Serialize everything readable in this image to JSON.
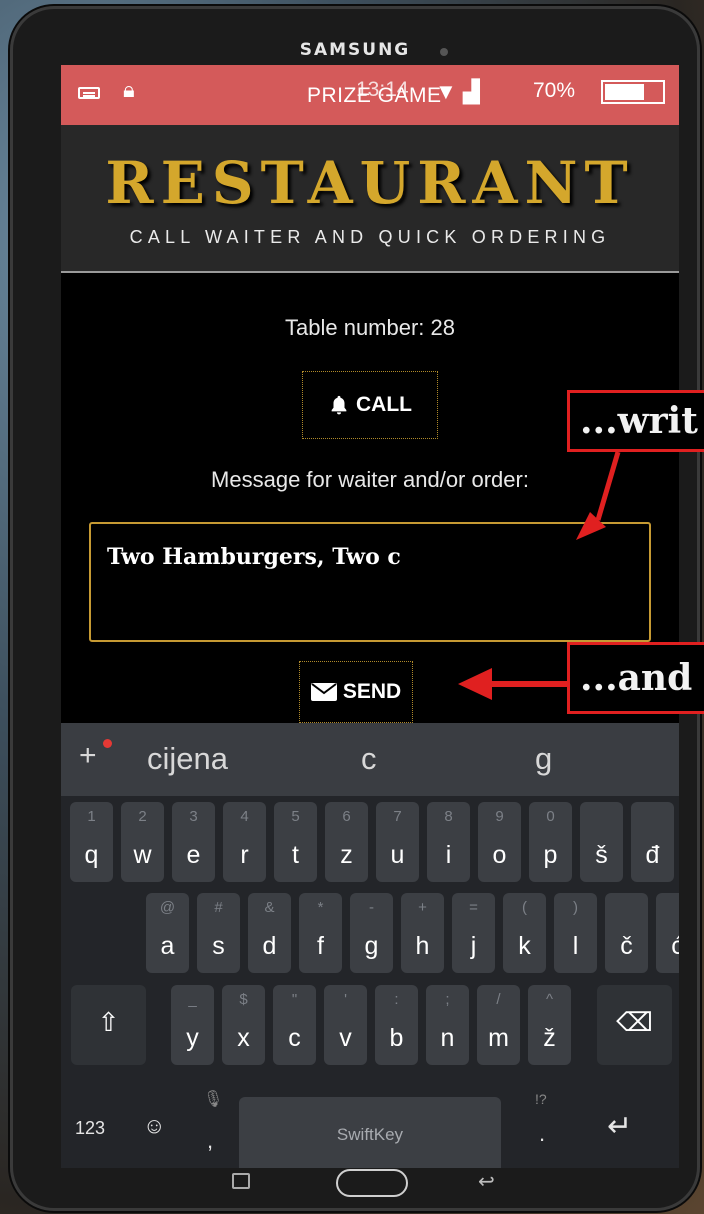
{
  "device": {
    "brand": "SAMSUNG"
  },
  "status_bar": {
    "app_name": "PRIZE GAME",
    "time": "13:14",
    "battery": "70%",
    "battery_level": 0.7,
    "bg_color": "#d45a5a"
  },
  "header": {
    "title": "RESTAURANT",
    "subtitle": "CALL WAITER AND QUICK ORDERING",
    "title_color": "#d4a72c"
  },
  "main": {
    "table_label": "Table number: 28",
    "call_button": "CALL",
    "message_label": "Message for waiter and/or order:",
    "message_value": "Two Hamburgers, Two c",
    "send_button": "SEND"
  },
  "keyboard": {
    "suggestions": [
      "cijena",
      "c",
      "g"
    ],
    "rows": [
      [
        {
          "p": "q",
          "s": "1"
        },
        {
          "p": "w",
          "s": "2"
        },
        {
          "p": "e",
          "s": "3"
        },
        {
          "p": "r",
          "s": "4"
        },
        {
          "p": "t",
          "s": "5"
        },
        {
          "p": "z",
          "s": "6"
        },
        {
          "p": "u",
          "s": "7"
        },
        {
          "p": "i",
          "s": "8"
        },
        {
          "p": "o",
          "s": "9"
        },
        {
          "p": "p",
          "s": "0"
        },
        {
          "p": "š",
          "s": ""
        },
        {
          "p": "đ",
          "s": ""
        }
      ],
      [
        {
          "p": "a",
          "s": "@"
        },
        {
          "p": "s",
          "s": "#"
        },
        {
          "p": "d",
          "s": "&"
        },
        {
          "p": "f",
          "s": "*"
        },
        {
          "p": "g",
          "s": "-"
        },
        {
          "p": "h",
          "s": "+"
        },
        {
          "p": "j",
          "s": "="
        },
        {
          "p": "k",
          "s": "("
        },
        {
          "p": "l",
          "s": ")"
        },
        {
          "p": "č",
          "s": ""
        },
        {
          "p": "ć",
          "s": ""
        }
      ],
      [
        {
          "p": "y",
          "s": "_"
        },
        {
          "p": "x",
          "s": "$"
        },
        {
          "p": "c",
          "s": "\""
        },
        {
          "p": "v",
          "s": "'"
        },
        {
          "p": "b",
          "s": ":"
        },
        {
          "p": "n",
          "s": ";"
        },
        {
          "p": "m",
          "s": "/"
        },
        {
          "p": "ž",
          "s": "^"
        }
      ]
    ],
    "mode_key": "123",
    "space_label": "SwiftKey",
    "comma_key": ",",
    "period_key": ".",
    "period_secondary": "!?",
    "icons": [
      "shift-icon",
      "backspace-icon",
      "emoji-icon",
      "mic-icon",
      "enter-icon"
    ]
  },
  "callouts": {
    "write": "...writ",
    "and": "...and"
  },
  "accent_colors": {
    "callout_border": "#e02020",
    "input_border": "#c69a33"
  }
}
